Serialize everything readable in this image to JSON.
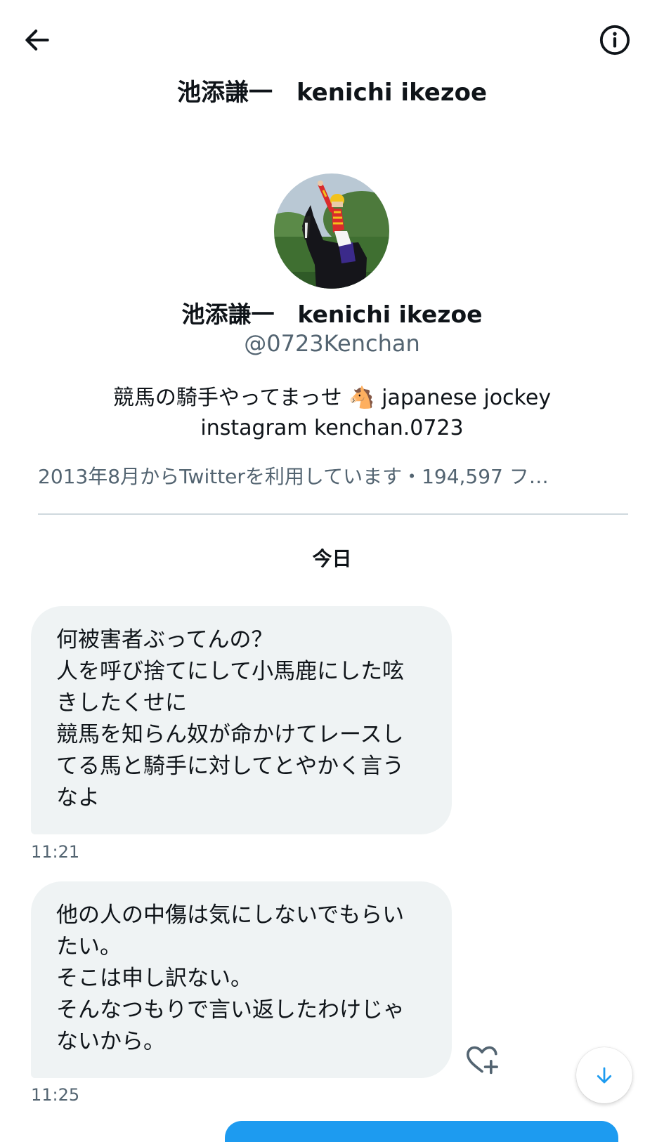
{
  "header": {
    "title": "池添謙一　kenichi ikezoe",
    "back_icon": "arrow-left-icon",
    "info_icon": "info-circle-icon"
  },
  "profile": {
    "name": "池添謙一　kenichi ikezoe",
    "handle": "@0723Kenchan",
    "bio_line1": "競馬の騎手やってまっせ 🐴 japanese jockey",
    "bio_line2": "instagram kenchan.0723",
    "meta": "2013年8月からTwitterを利用しています・194,597 フ…"
  },
  "conversation": {
    "date_separator": "今日",
    "messages": [
      {
        "lines": [
          "何被害者ぶってんの？",
          "人を呼び捨てにして小馬鹿にした呟",
          "きしたくせに",
          "競馬を知らん奴が命かけてレースし",
          "てる馬と騎手に対してとやかく言う",
          "なよ"
        ],
        "time": "11:21"
      },
      {
        "lines": [
          "他の人の中傷は気にしないでもらい",
          "たい。",
          "そこは申し訳ない。",
          "そんなつもりで言い返したわけじゃ",
          "ないから。"
        ],
        "time": "11:25"
      }
    ]
  },
  "colors": {
    "accent": "#1d9bf0",
    "bubble": "#eff3f4",
    "secondary_text": "#536471",
    "divider": "#cfd9de"
  },
  "icons": {
    "react": "heart-plus-icon",
    "scroll_down": "arrow-down-icon"
  }
}
